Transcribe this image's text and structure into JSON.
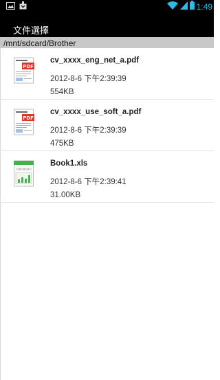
{
  "status_bar": {
    "time": "1:49",
    "icons": [
      "image-icon",
      "download-icon",
      "wifi-icon",
      "signal-icon",
      "battery-icon"
    ],
    "accent_color": "#33b5e5"
  },
  "title_bar": {
    "title": "文件選擇"
  },
  "path_bar": {
    "path": "/mnt/sdcard/Brother"
  },
  "files": [
    {
      "name": "cv_xxxx_eng_net_a.pdf",
      "date": "2012-8-6 下午2:39:39",
      "size": "554KB",
      "icon": "pdf-file-icon",
      "icon_badge": "PDF"
    },
    {
      "name": "cv_xxxx_use_soft_a.pdf",
      "date": "2012-8-6 下午2:39:39",
      "size": "475KB",
      "icon": "pdf-file-icon",
      "icon_badge": "PDF"
    },
    {
      "name": "Book1.xls",
      "date": "2012-8-6 下午2:39:41",
      "size": "31.00KB",
      "icon": "spreadsheet-file-icon"
    }
  ]
}
